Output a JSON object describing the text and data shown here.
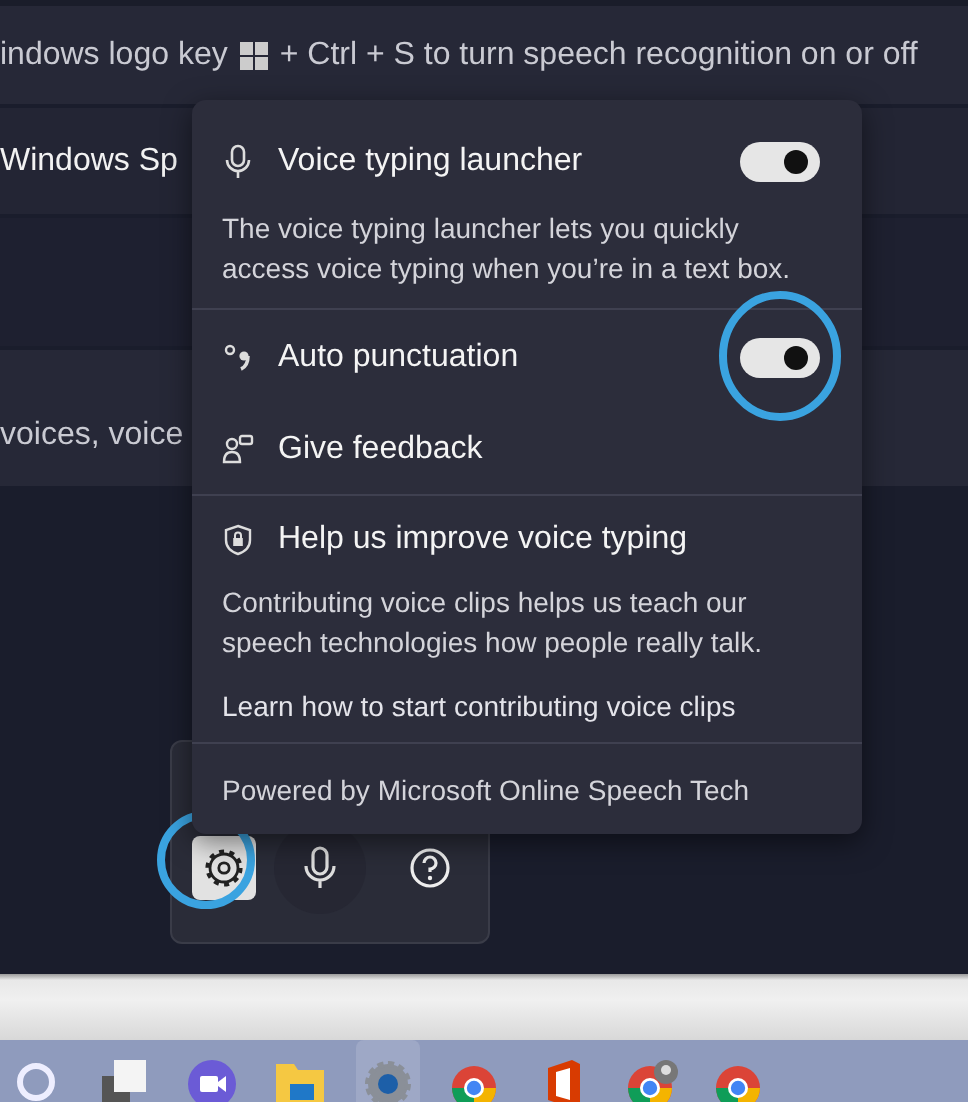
{
  "background": {
    "shortcut_start": "indows logo key",
    "shortcut_end": "+ Ctrl + S to turn speech recognition on or off",
    "row_2_text": "Windows Sp",
    "row_4_text": "voices, voice"
  },
  "popup": {
    "items": [
      {
        "kind": "toggle",
        "label": "Voice typing launcher",
        "on": true,
        "description": "The voice typing launcher lets you quickly access voice typing when you’re in a text box."
      },
      {
        "kind": "toggle",
        "label": "Auto punctuation",
        "on": true
      },
      {
        "kind": "feedback",
        "label": "Give feedback"
      }
    ],
    "help": {
      "title": "Help us improve voice typing",
      "description": "Contributing voice clips helps us teach our speech technologies how people really talk.",
      "link": "Learn how to start contributing voice clips"
    },
    "footer": "Powered by Microsoft Online Speech Tech"
  },
  "voice_bar": {
    "buttons": [
      {
        "kind": "settings",
        "selected": true
      },
      {
        "kind": "mic",
        "selected": false
      },
      {
        "kind": "help",
        "selected": false
      }
    ]
  },
  "taskbar": [
    {
      "kind": "search",
      "selected": false
    },
    {
      "kind": "taskview",
      "selected": false
    },
    {
      "kind": "meet",
      "selected": false
    },
    {
      "kind": "folder",
      "selected": false
    },
    {
      "kind": "settings",
      "selected": true
    },
    {
      "kind": "browser",
      "selected": false
    },
    {
      "kind": "office",
      "selected": false
    },
    {
      "kind": "browser-profile",
      "selected": false
    },
    {
      "kind": "browser",
      "selected": false
    }
  ]
}
